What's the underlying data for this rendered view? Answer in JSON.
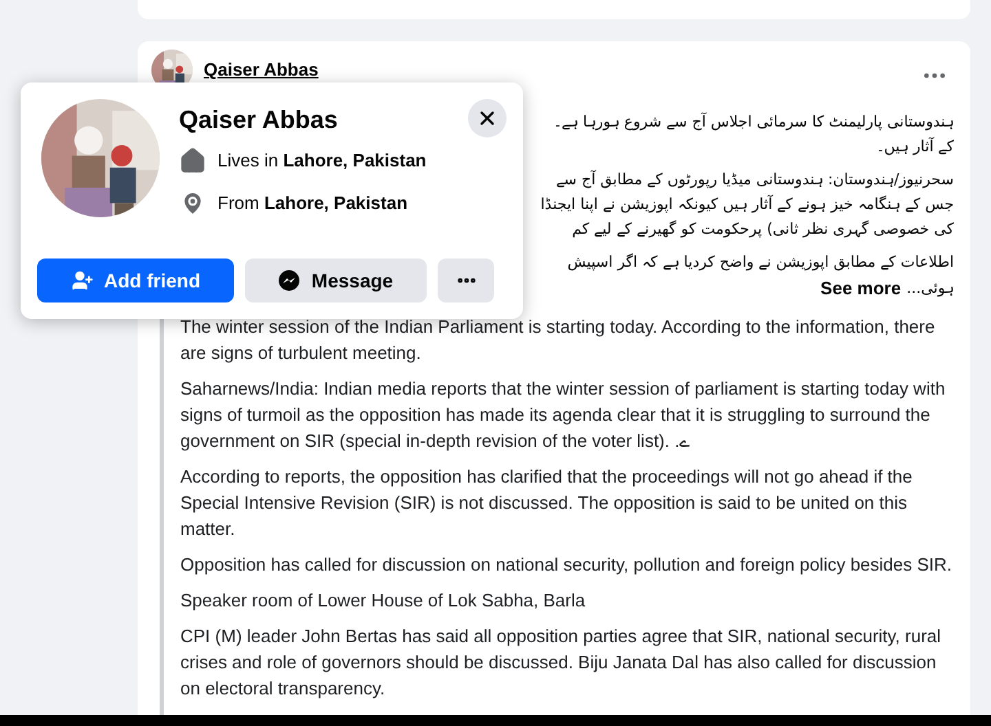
{
  "post": {
    "author": "Qaiser Abbas",
    "urdu_paragraphs": [
      [
        "ہندوستانی پارلیمنٹ کا سرمائی اجلاس آج سے شروع ہورہا ہے۔",
        "کے آثار ہیں۔"
      ],
      [
        "سحرنیوز/ہندوستان: ہندوستانی میڈیا رپورٹوں کے مطابق آج سے",
        "جس کے ہنگامہ خیز ہونے کے آثار ہیں کیونکہ اپوزیشن نے اپنا ایجنڈا",
        "کی خصوصی گہری نظر ثانی) پرحکومت کو گھیرنے کے لیے کم"
      ],
      [
        "اطلاعات کے مطابق اپوزیشن نے واضح کردیا ہے کہ اگر اسپیش"
      ]
    ],
    "urdu_tail": "ہوئی...",
    "see_more": "See more",
    "english_paragraphs": [
      "The winter session of the Indian Parliament is starting today. According to the information, there are signs of turbulent meeting.",
      "Saharnews/India: Indian media reports that the winter session of parliament is starting today with signs of turmoil as the opposition has made its agenda clear that it is struggling to surround the government on SIR (special in-depth revision of the voter list). .ے",
      "According to reports, the opposition has clarified that the proceedings will not go ahead if the Special Intensive Revision (SIR) is not discussed. The opposition is said to be united on this matter.",
      "Opposition has called for discussion on national security, pollution and foreign policy besides SIR.",
      "Speaker room of Lower House of Lok Sabha, Barla",
      "CPI (M) leader John Bertas has said all opposition parties agree that SIR, national security, rural crises and role of governors should be discussed. Biju Janata Dal has also called for discussion on electoral transparency."
    ]
  },
  "profile_card": {
    "name": "Qaiser Abbas",
    "details": [
      {
        "kind": "lives",
        "prefix": "Lives in",
        "place": "Lahore, Pakistan"
      },
      {
        "kind": "from",
        "prefix": "From",
        "place": "Lahore, Pakistan"
      }
    ],
    "add_friend_button": "Add friend",
    "message_button": "Message"
  }
}
